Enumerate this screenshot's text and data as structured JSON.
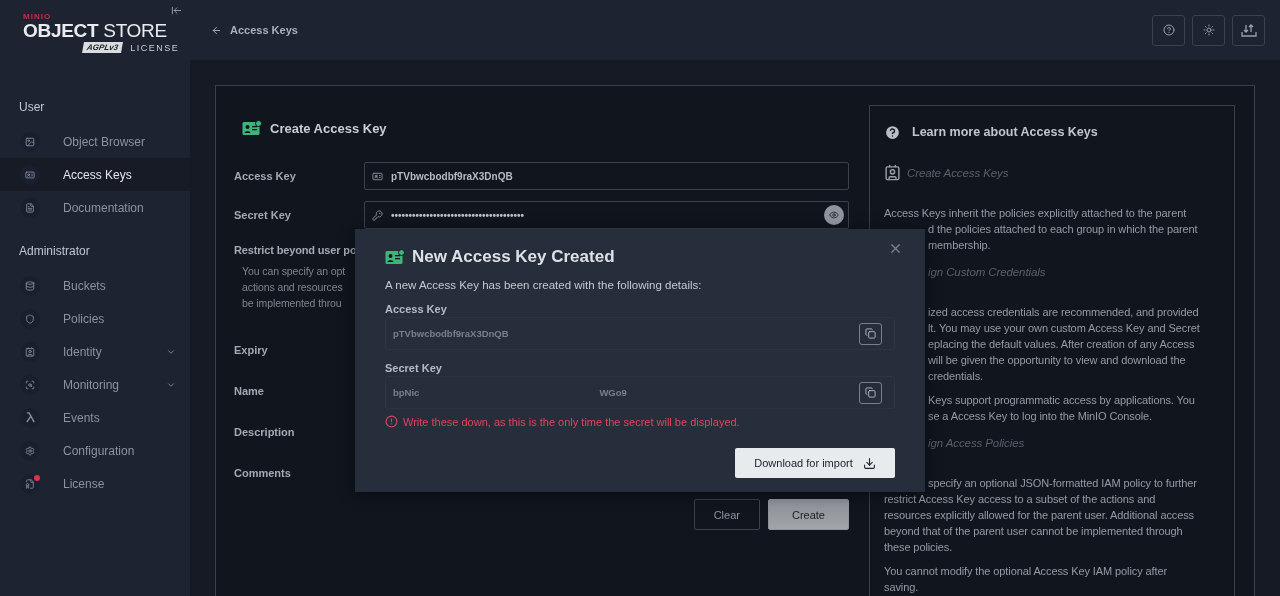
{
  "sidebar": {
    "logo": {
      "brand": "MINIO",
      "product": "**OBJECT** STORE",
      "badge": "AGPLv3",
      "edition": "LICENSE"
    },
    "sections": [
      {
        "title": "User",
        "items": [
          {
            "label": "Object Browser",
            "kind": "link",
            "selected": false,
            "alert": false
          },
          {
            "label": "Access Keys",
            "kind": "link",
            "selected": true,
            "alert": false
          },
          {
            "label": "Documentation",
            "kind": "link",
            "selected": false,
            "alert": false
          }
        ]
      },
      {
        "title": "Administrator",
        "items": [
          {
            "label": "Buckets",
            "kind": "link",
            "selected": false,
            "alert": false
          },
          {
            "label": "Policies",
            "kind": "link",
            "selected": false,
            "alert": false
          },
          {
            "label": "Identity",
            "kind": "group",
            "selected": false,
            "alert": false
          },
          {
            "label": "Monitoring",
            "kind": "group",
            "selected": false,
            "alert": false
          },
          {
            "label": "Events",
            "kind": "link",
            "selected": false,
            "alert": false
          },
          {
            "label": "Configuration",
            "kind": "link",
            "selected": false,
            "alert": false
          },
          {
            "label": "License",
            "kind": "link",
            "selected": false,
            "alert": true
          }
        ]
      }
    ]
  },
  "header": {
    "back_label": "Access Keys"
  },
  "form": {
    "title": "Create Access Key",
    "fields": [
      {
        "label": "Access Key",
        "kind": "text",
        "value": "pTVbwcbodbf9raX3DnQB"
      },
      {
        "label": "Secret Key",
        "kind": "password",
        "value": "••••••••••••••••••••••••••••••••••••••"
      }
    ],
    "restrict": {
      "label": "Restrict beyond user po",
      "lines": [
        "You can specify an opt",
        "actions and resources",
        "be implemented throu"
      ]
    },
    "labels": [
      "Expiry",
      "Name",
      "Description",
      "Comments"
    ],
    "buttons": [
      {
        "label": "Clear",
        "kind": "secondary"
      },
      {
        "label": "Create",
        "kind": "primary"
      }
    ]
  },
  "help": {
    "title": "Learn more about Access Keys",
    "paragraphs": [
      {
        "kind": "heading",
        "lines": [
          {
            "text": "Create Access Keys",
            "covered": false
          }
        ]
      },
      {
        "kind": "text",
        "lines": [
          {
            "text": "Access Keys inherit the policies explicitly attached to the parent",
            "covered": false
          },
          {
            "text": "d the policies attached to each group in which the parent",
            "covered": true
          },
          {
            "text": "membership.",
            "covered": true
          }
        ]
      },
      {
        "kind": "heading",
        "lines": [
          {
            "text": "ign Custom Credentials",
            "covered": true
          }
        ]
      },
      {
        "kind": "text",
        "lines": [
          {
            "text": "ized access credentials are recommended, and provided",
            "covered": true
          },
          {
            "text": "lt. You may use your own custom Access Key and Secret",
            "covered": true
          },
          {
            "text": "eplacing the default values. After creation of any Access",
            "covered": true
          },
          {
            "text": "will be given the opportunity to view and download the",
            "covered": true
          },
          {
            "text": "credentials.",
            "covered": true
          }
        ]
      },
      {
        "kind": "text",
        "lines": [
          {
            "text": "Keys support programmatic access by applications. You",
            "covered": true
          },
          {
            "text": "se a Access Key to log into the MinIO Console.",
            "covered": true
          }
        ]
      },
      {
        "kind": "heading",
        "lines": [
          {
            "text": "ign Access Policies",
            "covered": true
          }
        ]
      },
      {
        "kind": "text",
        "lines": [
          {
            "text": "specify an optional JSON-formatted IAM policy to further",
            "covered": true
          },
          {
            "text": "restrict Access Key access to a subset of the actions and",
            "covered": false
          },
          {
            "text": "resources explicitly allowed for the parent user. Additional access",
            "covered": false
          },
          {
            "text": "beyond that of the parent user cannot be implemented through",
            "covered": false
          },
          {
            "text": "these policies.",
            "covered": false
          }
        ]
      },
      {
        "kind": "text",
        "lines": [
          {
            "text": "You cannot modify the optional Access Key IAM policy after",
            "covered": false
          },
          {
            "text": "saving.",
            "covered": false
          }
        ]
      }
    ]
  },
  "modal": {
    "title": "New Access Key Created",
    "intro": "A new Access Key has been created with the following details:",
    "fields": [
      {
        "label": "Access Key",
        "parts": [
          "pTVbwcbodbf9raX3DnQB"
        ]
      },
      {
        "label": "Secret Key",
        "parts": [
          "bpNic",
          "WGo9"
        ]
      }
    ],
    "warning": "Write these down, as this is the only time the secret will be displayed.",
    "download": "Download for import"
  }
}
